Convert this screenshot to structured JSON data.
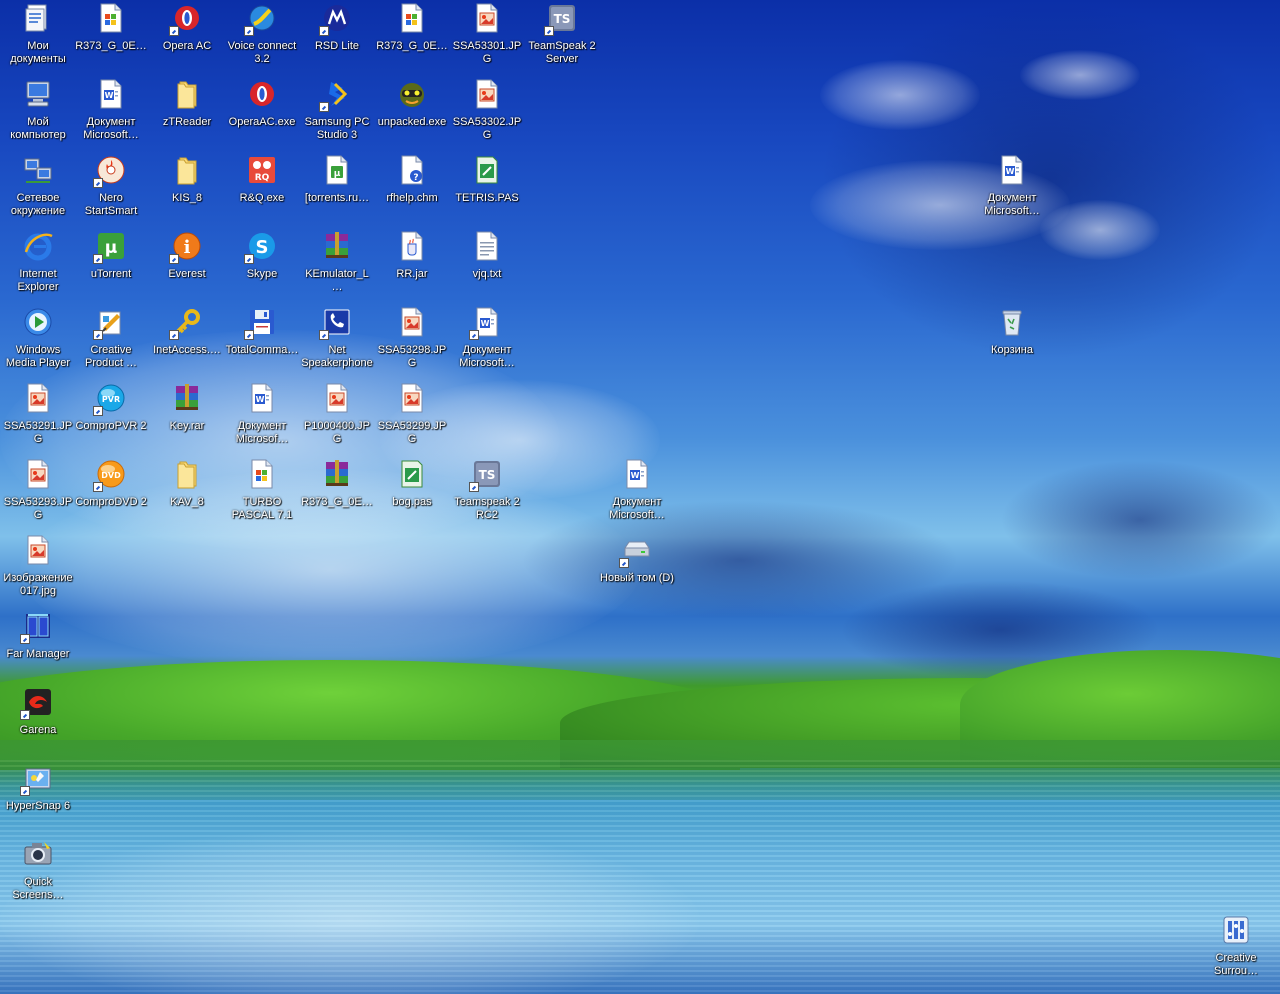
{
  "desktop": {
    "icons": [
      {
        "id": "my-documents",
        "label": "Мои документы",
        "type": "mydocs",
        "shortcut": false
      },
      {
        "id": "r373-doc-1",
        "label": "R373_G_0E…",
        "type": "setup",
        "shortcut": false
      },
      {
        "id": "opera-ac",
        "label": "Opera AC",
        "type": "opera",
        "shortcut": true
      },
      {
        "id": "voice-connect",
        "label": "Voice connect 3.2",
        "type": "voice",
        "shortcut": true
      },
      {
        "id": "rsd-lite",
        "label": "RSD Lite",
        "type": "motorola",
        "shortcut": true
      },
      {
        "id": "r373-doc-2",
        "label": "R373_G_0E…",
        "type": "setup",
        "shortcut": false
      },
      {
        "id": "ssa53301",
        "label": "SSA53301.JPG",
        "type": "jpg",
        "shortcut": false
      },
      {
        "id": "teamspeak-server",
        "label": "TeamSpeak 2 Server",
        "type": "teamspeak",
        "shortcut": true
      },
      {
        "id": "my-computer",
        "label": "Мой компьютер",
        "type": "computer",
        "shortcut": false
      },
      {
        "id": "word-doc-1",
        "label": "Документ Microsoft…",
        "type": "word",
        "shortcut": false
      },
      {
        "id": "ztreader",
        "label": "zTReader",
        "type": "folder",
        "shortcut": false
      },
      {
        "id": "operaac-exe",
        "label": "OperaAC.exe",
        "type": "opera",
        "shortcut": false
      },
      {
        "id": "samsung-pc-studio",
        "label": "Samsung PC Studio 3",
        "type": "samsung",
        "shortcut": true
      },
      {
        "id": "unpacked-exe",
        "label": "unpacked.exe",
        "type": "unpacked",
        "shortcut": false
      },
      {
        "id": "ssa53302",
        "label": "SSA53302.JPG",
        "type": "jpg",
        "shortcut": false
      },
      {
        "id": "network",
        "label": "Сетевое окружение",
        "type": "network",
        "shortcut": false
      },
      {
        "id": "nero",
        "label": "Nero StartSmart",
        "type": "nero",
        "shortcut": true
      },
      {
        "id": "kis8",
        "label": "KIS_8",
        "type": "folder",
        "shortcut": false
      },
      {
        "id": "rq-exe",
        "label": "R&Q.exe",
        "type": "rq",
        "shortcut": false
      },
      {
        "id": "torrents-ru",
        "label": "[torrents.ru…",
        "type": "torrentfile",
        "shortcut": false
      },
      {
        "id": "rfhelp",
        "label": "rfhelp.chm",
        "type": "chm",
        "shortcut": false
      },
      {
        "id": "tetris-pas",
        "label": "TETRIS.PAS",
        "type": "pas",
        "shortcut": false
      },
      {
        "id": "word-doc-2",
        "label": "Документ Microsoft…",
        "type": "word",
        "shortcut": false
      },
      {
        "id": "internet-explorer",
        "label": "Internet Explorer",
        "type": "ie",
        "shortcut": false
      },
      {
        "id": "utorrent",
        "label": "uTorrent",
        "type": "utorrent",
        "shortcut": true
      },
      {
        "id": "everest",
        "label": "Everest",
        "type": "everest",
        "shortcut": true
      },
      {
        "id": "skype",
        "label": "Skype",
        "type": "skype",
        "shortcut": true
      },
      {
        "id": "kemulator",
        "label": "KEmulator_L…",
        "type": "rar",
        "shortcut": false
      },
      {
        "id": "rr-jar",
        "label": "RR.jar",
        "type": "jar",
        "shortcut": false
      },
      {
        "id": "vjq-txt",
        "label": "vjq.txt",
        "type": "txt",
        "shortcut": false
      },
      {
        "id": "wmp",
        "label": "Windows Media Player",
        "type": "wmp",
        "shortcut": false
      },
      {
        "id": "creative-product",
        "label": "Creative Product …",
        "type": "creative",
        "shortcut": true
      },
      {
        "id": "inetaccess",
        "label": "InetAccess.…",
        "type": "key",
        "shortcut": true
      },
      {
        "id": "totalcommander",
        "label": "TotalComma…",
        "type": "floppy",
        "shortcut": true
      },
      {
        "id": "net-speakerphone",
        "label": "Net Speakerphone",
        "type": "phone",
        "shortcut": true
      },
      {
        "id": "ssa53298",
        "label": "SSA53298.JPG",
        "type": "jpg",
        "shortcut": false
      },
      {
        "id": "word-doc-3",
        "label": "Документ Microsoft…",
        "type": "word",
        "shortcut": true
      },
      {
        "id": "recycle-bin",
        "label": "Корзина",
        "type": "recycle",
        "shortcut": false
      },
      {
        "id": "ssa53291",
        "label": "SSA53291.JPG",
        "type": "jpg",
        "shortcut": false
      },
      {
        "id": "compro-pvr",
        "label": "ComproPVR 2",
        "type": "pvr",
        "shortcut": true
      },
      {
        "id": "key-rar",
        "label": "Key.rar",
        "type": "rar",
        "shortcut": false
      },
      {
        "id": "word-doc-4",
        "label": "Документ Microsof…",
        "type": "word",
        "shortcut": false
      },
      {
        "id": "p1000400",
        "label": "P1000400.JPG",
        "type": "jpg",
        "shortcut": false
      },
      {
        "id": "ssa53299",
        "label": "SSA53299.JPG",
        "type": "jpg",
        "shortcut": false
      },
      {
        "id": "ssa53293",
        "label": "SSA53293.JPG",
        "type": "jpg",
        "shortcut": false
      },
      {
        "id": "compro-dvd",
        "label": "ComproDVD 2",
        "type": "dvd",
        "shortcut": true
      },
      {
        "id": "kav8",
        "label": "KAV_8",
        "type": "folder",
        "shortcut": false
      },
      {
        "id": "turbo-pascal",
        "label": "TURBO PASCAL 7.1",
        "type": "setup",
        "shortcut": false
      },
      {
        "id": "r373-rar",
        "label": "R373_G_0E…",
        "type": "rar",
        "shortcut": false
      },
      {
        "id": "bog-pas",
        "label": "bog.pas",
        "type": "pas",
        "shortcut": false
      },
      {
        "id": "teamspeak-rc2",
        "label": "Teamspeak 2 RC2",
        "type": "teamspeak",
        "shortcut": true
      },
      {
        "id": "word-doc-5",
        "label": "Документ Microsoft…",
        "type": "word",
        "shortcut": false
      },
      {
        "id": "image-017",
        "label": "Изображение 017.jpg",
        "type": "jpg",
        "shortcut": false
      },
      {
        "id": "drive-d",
        "label": "Новый том (D)",
        "type": "drive",
        "shortcut": true
      },
      {
        "id": "far-manager",
        "label": "Far Manager",
        "type": "far",
        "shortcut": true
      },
      {
        "id": "garena",
        "label": "Garena",
        "type": "garena",
        "shortcut": true
      },
      {
        "id": "hypersnap",
        "label": "HyperSnap 6",
        "type": "hypersnap",
        "shortcut": true
      },
      {
        "id": "quick-screenshot",
        "label": "Quick Screens…",
        "type": "camera",
        "shortcut": false
      },
      {
        "id": "creative-surround",
        "label": "Creative Surrou…",
        "type": "surround",
        "shortcut": false
      }
    ]
  }
}
